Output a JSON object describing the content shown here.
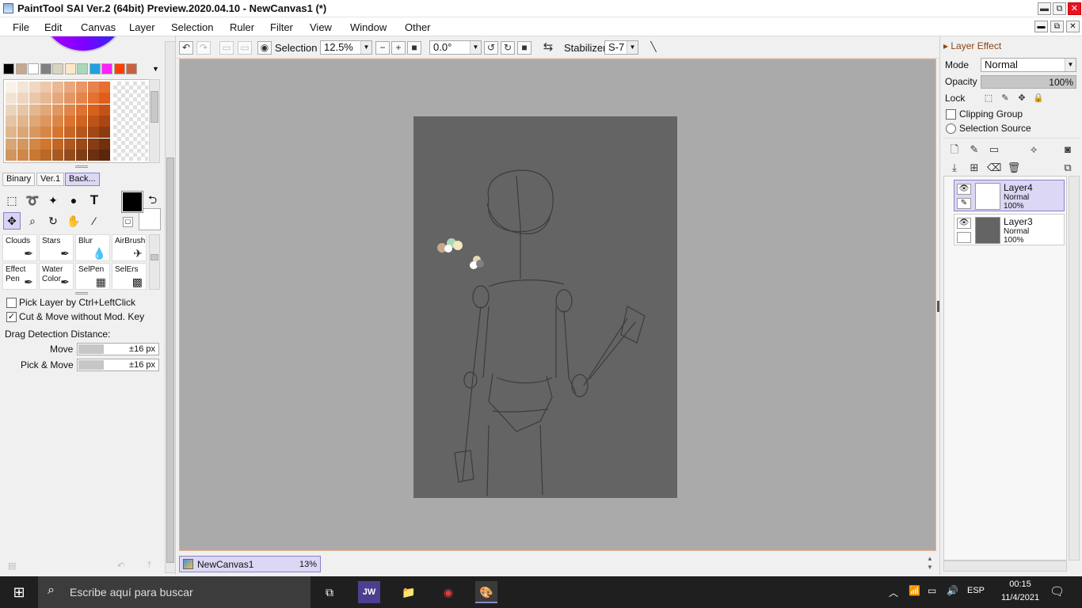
{
  "window": {
    "title": "PaintTool SAI Ver.2 (64bit) Preview.2020.04.10 - NewCanvas1 (*)",
    "min_label": "▬",
    "max_label": "⧉",
    "close_label": "✕"
  },
  "menubar": {
    "items": [
      "File",
      "Edit",
      "Canvas",
      "Layer",
      "Selection",
      "Ruler",
      "Filter",
      "View",
      "Window",
      "Other"
    ]
  },
  "colors": {
    "accent": "#dcd7f5",
    "canvas_bg": "#aaaaaa",
    "paper": "#646464",
    "primary_color": "#000000",
    "secondary_color": "#ffffff",
    "palette": [
      "#000000",
      "#c8a88c",
      "#ffffff",
      "#808080",
      "#d8d4c0",
      "#ffe8c8",
      "#a8d8b8",
      "#20a0e0",
      "#ff20ff",
      "#ff4000",
      "#c86040"
    ]
  },
  "left_panel": {
    "tabs": [
      "Binary",
      "Ver.1",
      "Back..."
    ],
    "tools": [
      "marquee-icon",
      "lasso-icon",
      "magic-wand-icon",
      "shapes-icon",
      "text-icon",
      "move-icon",
      "zoom-icon",
      "rotate-icon",
      "hand-icon",
      "eyedropper-icon"
    ],
    "text_tool_glyph": "T",
    "brushes": [
      {
        "line1": "Clouds",
        "line2": ""
      },
      {
        "line1": "Stars",
        "line2": ""
      },
      {
        "line1": "Blur",
        "line2": ""
      },
      {
        "line1": "AirBrush",
        "line2": ""
      },
      {
        "line1": "Effect",
        "line2": "Pen"
      },
      {
        "line1": "Water",
        "line2": "Color"
      },
      {
        "line1": "SelPen",
        "line2": ""
      },
      {
        "line1": "SelErs",
        "line2": ""
      }
    ],
    "options": {
      "pick_layer": "Pick Layer by Ctrl+LeftClick",
      "pick_layer_checked": false,
      "cut_move": "Cut & Move without Mod. Key",
      "cut_move_checked": true,
      "drag_label": "Drag Detection Distance:",
      "move_label": "Move",
      "move_value": "±16 px",
      "pickmove_label": "Pick & Move",
      "pickmove_value": "±16 px"
    }
  },
  "toolbar": {
    "selection_label": "Selection",
    "zoom": "12.5%",
    "rotation": "0.0°",
    "stabilizer_label": "Stabilizer",
    "stabilizer": "S-7"
  },
  "document_tab": {
    "name": "NewCanvas1",
    "zoom": "13%"
  },
  "right_panel": {
    "header": "Layer Effect",
    "mode_label": "Mode",
    "mode_value": "Normal",
    "opacity_label": "Opacity",
    "opacity_value": "100%",
    "lock_label": "Lock",
    "clipping_group": "Clipping Group",
    "selection_source": "Selection Source",
    "layers": [
      {
        "name": "Layer4",
        "mode": "Normal",
        "opacity": "100%",
        "selected": true
      },
      {
        "name": "Layer3",
        "mode": "Normal",
        "opacity": "100%",
        "selected": false
      }
    ]
  },
  "taskbar": {
    "search_placeholder": "Escribe aquí para buscar",
    "time": "00:15",
    "date": "11/4/2021",
    "language": "ESP",
    "jw_label": "JW"
  }
}
